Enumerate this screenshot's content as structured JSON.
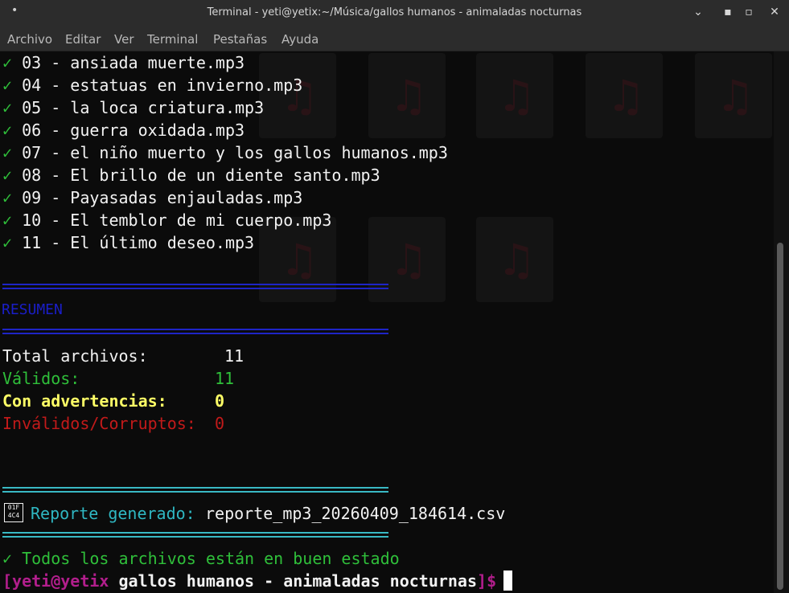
{
  "window": {
    "title": "Terminal - yeti@yetix:~/Música/gallos humanos - animaladas nocturnas"
  },
  "menubar": {
    "items": [
      "Archivo",
      "Editar",
      "Ver",
      "Terminal",
      "Pestañas",
      "Ayuda"
    ]
  },
  "terminal": {
    "files": [
      {
        "check": "✓",
        "text": " 03 - ansiada muerte.mp3"
      },
      {
        "check": "✓",
        "text": " 04 - estatuas en invierno.mp3"
      },
      {
        "check": "✓",
        "text": " 05 - la loca criatura.mp3"
      },
      {
        "check": "✓",
        "text": " 06 - guerra oxidada.mp3"
      },
      {
        "check": "✓",
        "text": " 07 - el niño muerto y los gallos humanos.mp3"
      },
      {
        "check": "✓",
        "text": " 08 - El brillo de un diente santo.mp3"
      },
      {
        "check": "✓",
        "text": " 09 - Payasadas enjauladas.mp3"
      },
      {
        "check": "✓",
        "text": " 10 - El temblor de mi cuerpo.mp3"
      },
      {
        "check": "✓",
        "text": " 11 - El último deseo.mp3"
      }
    ],
    "summary_heading": "RESUMEN",
    "summary": {
      "total_label": "Total archivos:",
      "total_value": "11",
      "valid_label": "Válidos:",
      "valid_value": "11",
      "warn_label": "Con advertencias:",
      "warn_value": "0",
      "invalid_label": "Inválidos/Corruptos:",
      "invalid_value": "0"
    },
    "report": {
      "icon_text": "01F 4C4",
      "label": "Reporte generado:",
      "filename": "reporte_mp3_20260409_184614.csv"
    },
    "final_message": "✓ Todos los archivos están en buen estado",
    "prompt": {
      "user_host": "[yeti@yetix",
      "path": "gallos humanos - animaladas nocturnas",
      "end": "]$"
    }
  }
}
